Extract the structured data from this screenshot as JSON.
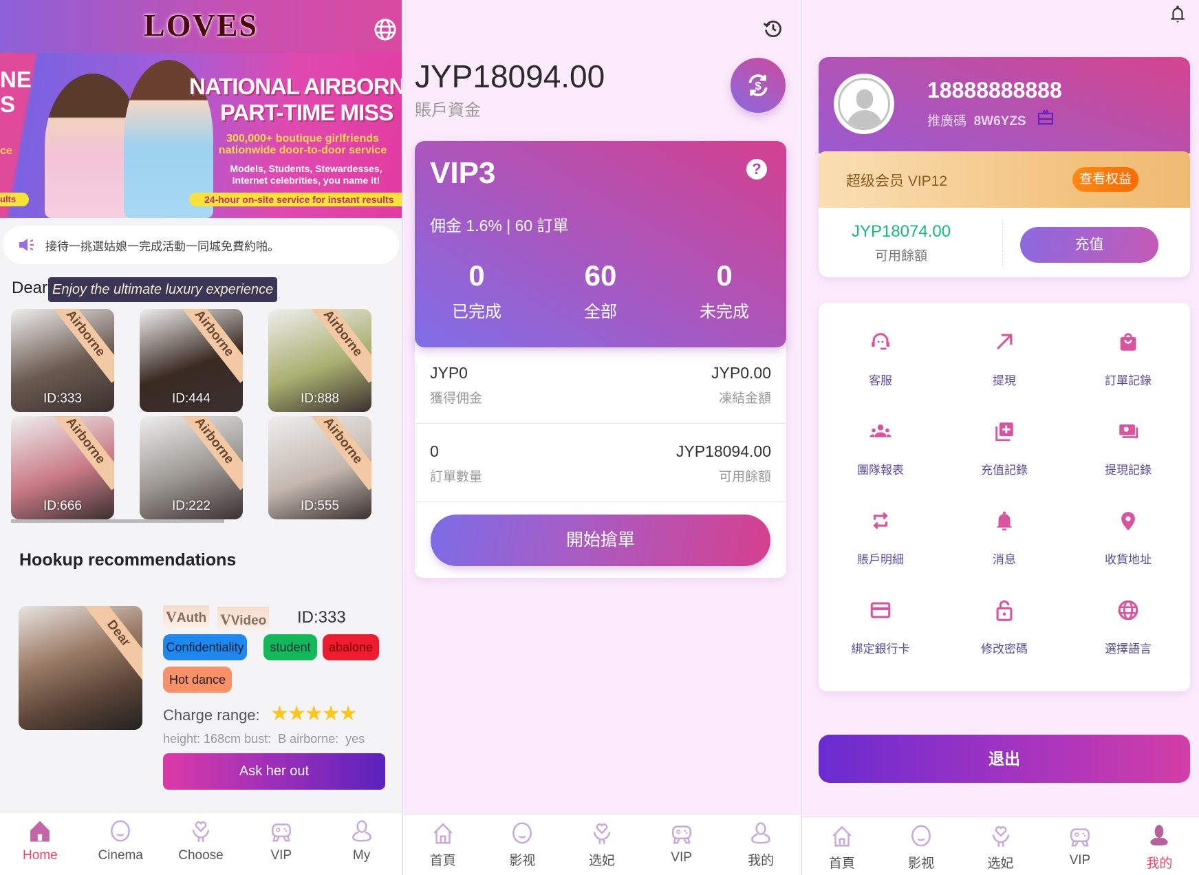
{
  "home": {
    "logo": "LOVES",
    "banner": {
      "headline1": "NATIONAL AIRBORNE",
      "headline2": "PART-TIME MISS",
      "line1": "300,000+ boutique girlfriends",
      "line2": "nationwide door-to-door service",
      "line3": "Models, Students, Stewardesses,",
      "line4": "Internet celebrities, you name it!",
      "pill": "24-hour on-site service for instant results",
      "left_fragment1": "NE",
      "left_fragment2": "S",
      "left_fragment3": "ce",
      "left_pill": "ults"
    },
    "notice": "接待一挑選姑娘一完成活動一同城免費約啪。",
    "section_title": "Dear",
    "tooltip": "Enjoy the ultimate luxury experience",
    "ribbon": "Airborne",
    "grid": [
      {
        "id": "ID:333",
        "tone": "#6b5a50"
      },
      {
        "id": "ID:444",
        "tone": "#3a2a22"
      },
      {
        "id": "ID:888",
        "tone": "#a9b070"
      },
      {
        "id": "ID:666",
        "tone": "#c97a86"
      },
      {
        "id": "ID:222",
        "tone": "#9a9590"
      },
      {
        "id": "ID:555",
        "tone": "#c4b8b0"
      }
    ],
    "recommend_title": "Hookup recommendations",
    "recommend": {
      "ribbon": "Dear",
      "badge_auth": "Auth",
      "badge_video": "Video",
      "id": "ID:333",
      "tags": [
        {
          "label": "Confidentiality",
          "color": "#1e88f0"
        },
        {
          "label": "student",
          "color": "#12b85a"
        },
        {
          "label": "abalone",
          "color": "#ee1c2e"
        },
        {
          "label": "Hot dance",
          "color": "#fa9068"
        }
      ],
      "charge_label": "Charge range:",
      "stars": 5,
      "details": "height: 168cm bust:  B airborne:  yes",
      "button": "Ask her out"
    },
    "nav": [
      "Home",
      "Cinema",
      "Choose",
      "VIP",
      "My"
    ],
    "nav_active": 0
  },
  "order": {
    "balance": "JYP18094.00",
    "balance_label": "賬戶資金",
    "vip": {
      "level": "VIP3",
      "info": "佣金 1.6% | 60 訂單",
      "stats": [
        {
          "value": "0",
          "label": "已完成"
        },
        {
          "value": "60",
          "label": "全部"
        },
        {
          "value": "0",
          "label": "未完成"
        }
      ]
    },
    "rows": [
      {
        "left_value": "JYP0",
        "left_label": "獲得佣金",
        "right_value": "JYP0.00",
        "right_label": "凍結金額"
      },
      {
        "left_value": "0",
        "left_label": "訂單數量",
        "right_value": "JYP18094.00",
        "right_label": "可用餘額"
      }
    ],
    "start_button": "開始搶單",
    "nav": [
      "首頁",
      "影视",
      "选妃",
      "VIP",
      "我的"
    ]
  },
  "profile": {
    "phone": "18888888888",
    "promo_label": "推廣碼",
    "promo_code": "8W6YZS",
    "member": "超级会员 VIP12",
    "benefits_button": "查看权益",
    "available": "JYP18074.00",
    "available_label": "可用餘額",
    "recharge_button": "充值",
    "menu": [
      {
        "label": "客服",
        "icon": "headset-icon"
      },
      {
        "label": "提現",
        "icon": "arrow-up-right-icon"
      },
      {
        "label": "訂單記錄",
        "icon": "shopping-bag-icon"
      },
      {
        "label": "團隊報表",
        "icon": "team-icon"
      },
      {
        "label": "充值記錄",
        "icon": "add-box-icon"
      },
      {
        "label": "提現記錄",
        "icon": "money-icon"
      },
      {
        "label": "賬戶明細",
        "icon": "swap-icon"
      },
      {
        "label": "消息",
        "icon": "bell-icon"
      },
      {
        "label": "收貨地址",
        "icon": "location-pin-icon"
      },
      {
        "label": "綁定銀行卡",
        "icon": "credit-card-icon"
      },
      {
        "label": "修改密碼",
        "icon": "lock-icon"
      },
      {
        "label": "選擇語言",
        "icon": "globe-icon"
      }
    ],
    "logout": "退出",
    "nav": [
      "首頁",
      "影视",
      "选妃",
      "VIP",
      "我的"
    ],
    "nav_active": 4
  },
  "colors": {
    "accent_pink": "#d9539f",
    "active_nav": "#f0436a",
    "green_balance": "#17b978",
    "orange": "#ff7a12"
  }
}
